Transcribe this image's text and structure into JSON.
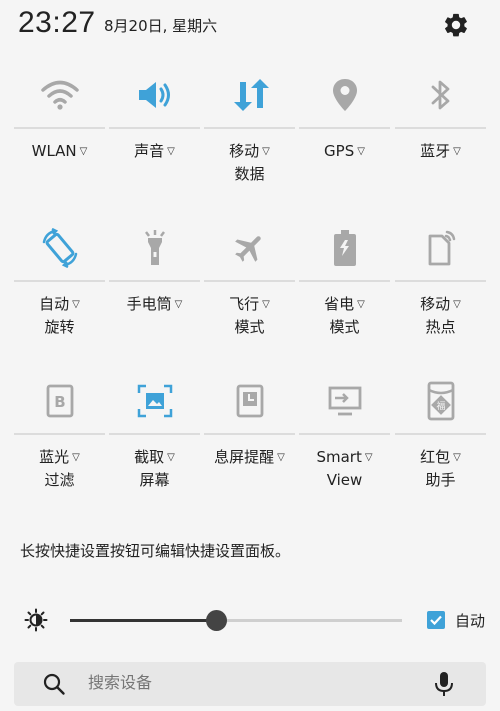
{
  "status": {
    "time": "23:27",
    "date": "8月20日, 星期六"
  },
  "colors": {
    "accent": "#3fa2d8",
    "inactive_icon": "#9e9e9e",
    "text": "#222222"
  },
  "tiles": [
    [
      {
        "icon": "wifi-icon",
        "active": false,
        "lines": [
          "WLAN"
        ]
      },
      {
        "icon": "volume-icon",
        "active": true,
        "lines": [
          "声音"
        ]
      },
      {
        "icon": "mobile-data-icon",
        "active": true,
        "lines": [
          "移动",
          "数据"
        ]
      },
      {
        "icon": "gps-pin-icon",
        "active": false,
        "lines": [
          "GPS"
        ]
      },
      {
        "icon": "bluetooth-icon",
        "active": false,
        "lines": [
          "蓝牙"
        ]
      }
    ],
    [
      {
        "icon": "auto-rotate-icon",
        "active": true,
        "lines": [
          "自动",
          "旋转"
        ]
      },
      {
        "icon": "flashlight-icon",
        "active": false,
        "lines": [
          "手电筒"
        ]
      },
      {
        "icon": "airplane-icon",
        "active": false,
        "lines": [
          "飞行",
          "模式"
        ]
      },
      {
        "icon": "battery-saver-icon",
        "active": false,
        "lines": [
          "省电",
          "模式"
        ]
      },
      {
        "icon": "hotspot-icon",
        "active": false,
        "lines": [
          "移动",
          "热点"
        ]
      }
    ],
    [
      {
        "icon": "blue-light-filter-icon",
        "active": false,
        "lines": [
          "蓝光",
          "过滤"
        ]
      },
      {
        "icon": "screenshot-icon",
        "active": true,
        "lines": [
          "截取",
          "屏幕"
        ]
      },
      {
        "icon": "always-on-display-icon",
        "active": false,
        "lines": [
          "息屏提醒"
        ]
      },
      {
        "icon": "smart-view-icon",
        "active": false,
        "lines": [
          "Smart",
          "View"
        ]
      },
      {
        "icon": "red-envelope-icon",
        "active": false,
        "lines": [
          "红包",
          "助手"
        ]
      }
    ]
  ],
  "hint_text": "长按快捷设置按钮可编辑快捷设置面板。",
  "brightness": {
    "level": 0.44,
    "auto_label": "自动",
    "auto_checked": true
  },
  "search": {
    "placeholder": "搜索设备"
  }
}
